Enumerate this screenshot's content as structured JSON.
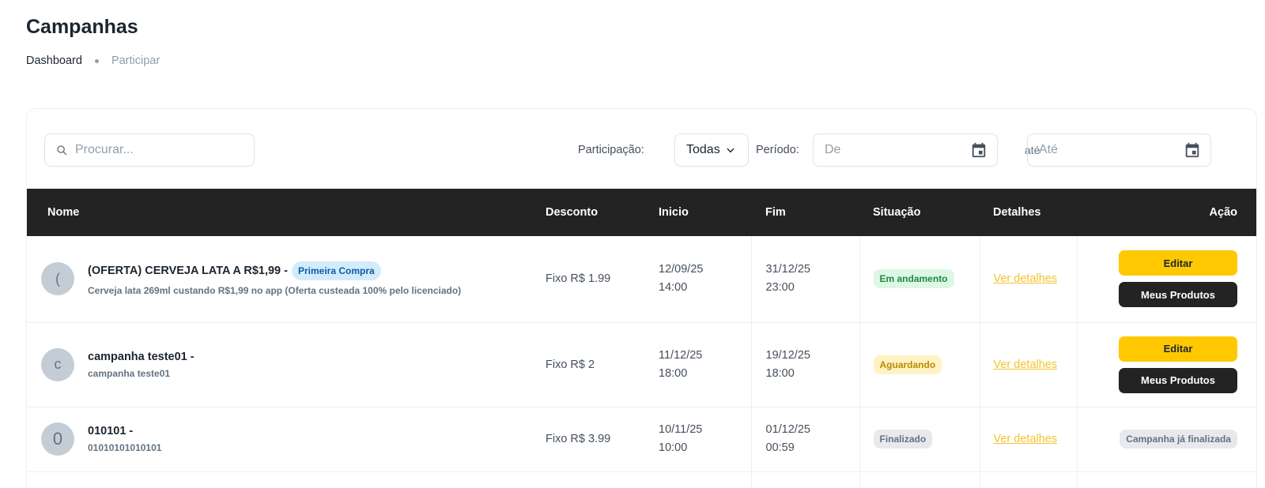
{
  "page": {
    "title": "Campanhas"
  },
  "breadcrumb": {
    "items": [
      "Dashboard",
      "Participar"
    ]
  },
  "toolbar": {
    "search_placeholder": "Procurar...",
    "participacao_label": "Participação:",
    "participacao_value": "Todas",
    "periodo_label": "Período:",
    "de_placeholder": "De",
    "ate_label": "até",
    "ate_placeholder": "Até"
  },
  "table": {
    "columns": [
      "Nome",
      "Desconto",
      "Inicio",
      "Fim",
      "Situação",
      "Detalhes",
      "Ação"
    ],
    "rows": [
      {
        "avatar": "(",
        "name": "(OFERTA) CERVEJA LATA A R$1,99 -",
        "tag": "Primeira Compra",
        "description": "Cerveja lata 269ml custando R$1,99 no app (Oferta custeada 100% pelo licenciado)",
        "discount": "Fixo R$ 1.99",
        "start_date": "12/09/25",
        "start_time": "14:00",
        "end_date": "31/12/25",
        "end_time": "23:00",
        "status": "Em andamento",
        "details_link": "Ver detalhes",
        "action_primary": "Editar",
        "action_secondary": "Meus Produtos"
      },
      {
        "avatar": "c",
        "name": "campanha teste01 -",
        "description": "campanha teste01",
        "discount": "Fixo R$ 2",
        "start_date": "11/12/25",
        "start_time": "18:00",
        "end_date": "19/12/25",
        "end_time": "18:00",
        "status": "Aguardando",
        "details_link": "Ver detalhes",
        "action_primary": "Editar",
        "action_secondary": "Meus Produtos"
      },
      {
        "avatar": "0",
        "name": "010101 -",
        "description": "01010101010101",
        "discount": "Fixo R$ 3.99",
        "start_date": "10/11/25",
        "start_time": "10:00",
        "end_date": "01/12/25",
        "end_time": "00:59",
        "status": "Finalizado",
        "details_link": "Ver detalhes",
        "action_label": "Campanha já finalizada"
      }
    ]
  },
  "colors": {
    "header_bg": "#232323",
    "accent_yellow": "#ffc800",
    "link_yellow": "#f3c32d",
    "status_active": "#1f8a3e",
    "status_waiting": "#b88a00",
    "status_done": "#637381",
    "tag_blue": "#0a5ca6"
  },
  "icons": [
    "search-icon",
    "chevron-down-icon",
    "calendar-icon"
  ]
}
